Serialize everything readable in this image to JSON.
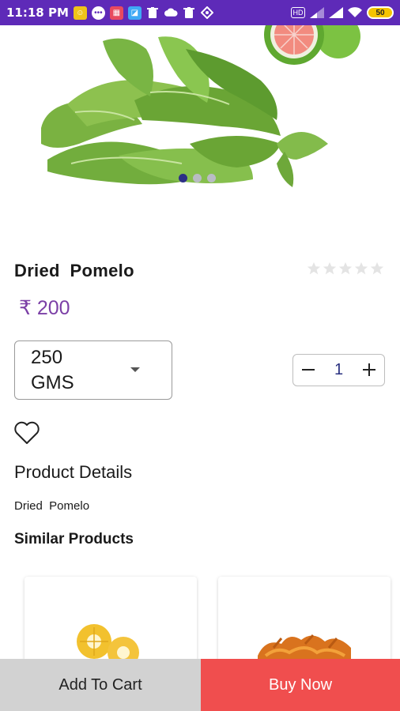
{
  "status_bar": {
    "time": "11:18 PM",
    "battery": "50",
    "notification_icons": [
      "app-icon",
      "chat-icon",
      "store-icon",
      "gallery-icon",
      "trash-icon",
      "cloud-icon",
      "trash-icon",
      "vpn-icon"
    ],
    "colors": {
      "background": "#5e2ab8"
    }
  },
  "product": {
    "name": "Dried  Pomelo",
    "price": "₹ 200",
    "rating_stars": 0,
    "rating_max": 5,
    "carousel": {
      "total": 3,
      "active": 1
    },
    "size_selected": "250 GMS",
    "quantity": "1"
  },
  "details": {
    "heading": "Product Details",
    "text": "Dried  Pomelo"
  },
  "similar": {
    "heading": "Similar Products",
    "items": [
      {
        "image": "dried-pineapple-image"
      },
      {
        "image": "dried-mango-image"
      }
    ]
  },
  "actions": {
    "add_to_cart": "Add To Cart",
    "buy_now": "Buy Now"
  },
  "colors": {
    "price": "#7b3fa6",
    "buy_button": "#f04e4e",
    "cart_button": "#d2d2d2"
  }
}
